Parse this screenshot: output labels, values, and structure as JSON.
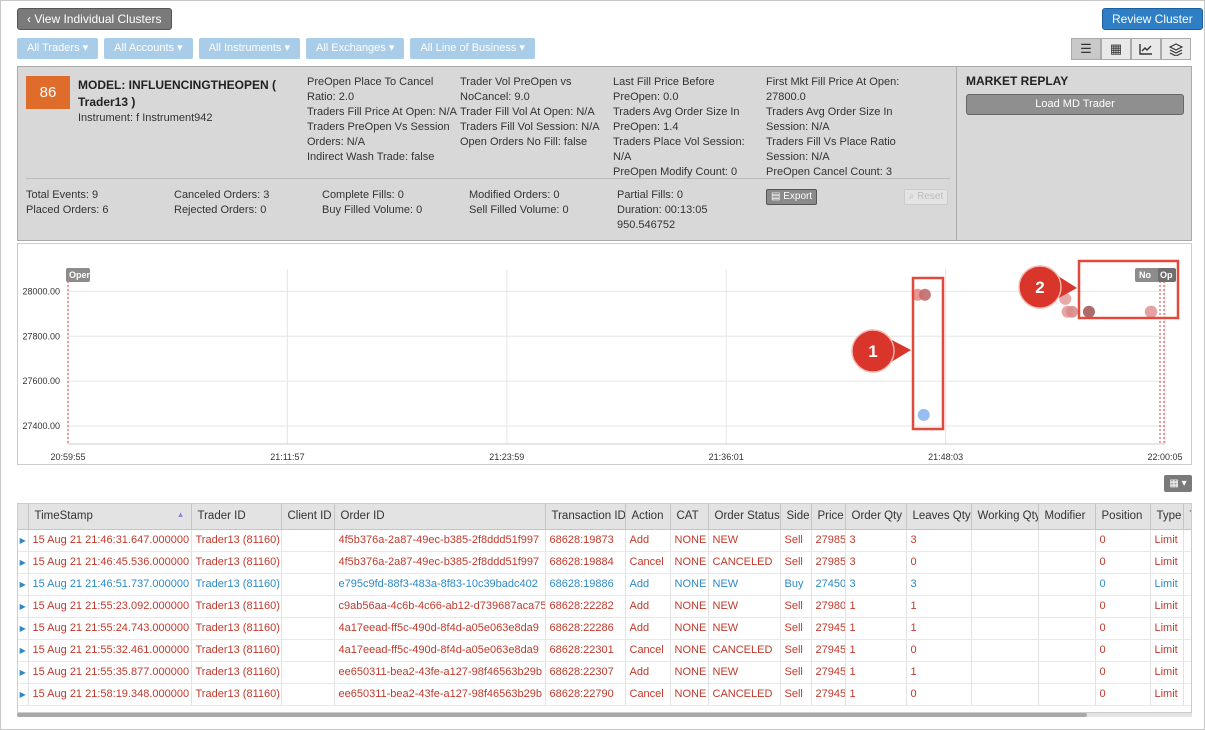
{
  "toolbar": {
    "back_label": "View Individual Clusters",
    "review_label": "Review Cluster",
    "filters": [
      "All Traders",
      "All Accounts",
      "All Instruments",
      "All Exchanges",
      "All Line of Business"
    ]
  },
  "cluster": {
    "score": "86",
    "model": "MODEL: INFLUENCINGTHEOPEN ( Trader13 )",
    "instrument": "Instrument: f Instrument942",
    "metrics_col1": [
      "PreOpen Place To Cancel Ratio: 2.0",
      "Traders Fill Price At Open: N/A",
      "Traders PreOpen Vs Session Orders: N/A",
      "Indirect Wash Trade: false"
    ],
    "metrics_col2": [
      "Trader Vol PreOpen vs NoCancel: 9.0",
      "Trader Fill Vol At Open: N/A",
      "Traders Fill Vol Session: N/A",
      "Open Orders No Fill: false"
    ],
    "metrics_col3": [
      "Last Fill Price Before PreOpen: 0.0",
      "Traders Avg Order Size In PreOpen: 1.4",
      "Traders Place Vol Session: N/A",
      "PreOpen Modify Count: 0"
    ],
    "metrics_col4": [
      "First Mkt Fill Price At Open: 27800.0",
      "Traders Avg Order Size In Session: N/A",
      "Traders Fill Vs Place Ratio Session: N/A",
      "PreOpen Cancel Count: 3"
    ],
    "stats": {
      "total_events": "Total Events: 9",
      "placed_orders": "Placed Orders: 6",
      "canceled_orders": "Canceled Orders: 3",
      "rejected_orders": "Rejected Orders: 0",
      "complete_fills": "Complete Fills: 0",
      "buy_filled": "Buy Filled Volume: 0",
      "modified_orders": "Modified Orders: 0",
      "sell_filled": "Sell Filled Volume: 0",
      "partial_fills": "Partial Fills: 0",
      "duration": "Duration: 00:13:05",
      "duration_ms": "950.546752"
    },
    "export_label": "Export",
    "reset_label": "Reset"
  },
  "market_replay": {
    "title": "MARKET REPLAY",
    "load_label": "Load MD Trader"
  },
  "chart_data": {
    "type": "scatter",
    "y_ticks": [
      "28000.00",
      "27800.00",
      "27600.00",
      "27400.00"
    ],
    "x_ticks": [
      "20:59:55",
      "21:11:57",
      "21:23:59",
      "21:36:01",
      "21:48:03",
      "22:00:05"
    ],
    "ylim": [
      27320,
      28100
    ],
    "grid": true,
    "labels": {
      "open_left": "Open",
      "no_left": "No",
      "open_right": "Op"
    },
    "callouts": [
      "1",
      "2"
    ],
    "series": [
      {
        "values": [
          {
            "x": "21:46:31",
            "y": 27985,
            "color": "#e98a8a"
          },
          {
            "x": "21:46:45",
            "y": 27985,
            "color": "#c26b6b"
          },
          {
            "x": "21:46:51",
            "y": 27450,
            "color": "#8cb6f0"
          },
          {
            "x": "21:55:23",
            "y": 27980,
            "color": "#e6a0a0"
          },
          {
            "x": "21:55:24",
            "y": 27945,
            "color": "#e69a9a"
          },
          {
            "x": "21:55:32",
            "y": 27945,
            "color": "#d88d8d"
          },
          {
            "x": "21:55:35",
            "y": 27945,
            "color": "#a45a5a"
          },
          {
            "x": "21:58:19",
            "y": 27945,
            "color": "#d98f8f"
          },
          {
            "x": "21:59:20",
            "y": 27945,
            "color": "#e4a3a3"
          }
        ]
      }
    ]
  },
  "table": {
    "columns": [
      "TimeStamp",
      "Trader ID",
      "Client ID",
      "Order ID",
      "Transaction ID",
      "Action",
      "CAT",
      "Order Status",
      "Side",
      "Price",
      "Order Qty",
      "Leaves Qty",
      "Working Qty",
      "Modifier",
      "Position",
      "Type",
      "T"
    ],
    "rows": [
      {
        "side": "sell",
        "cells": [
          "15 Aug 21 21:46:31.647.000000",
          "Trader13 (81160)",
          "",
          "4f5b376a-2a87-49ec-b385-2f8ddd51f997",
          "68628:19873",
          "Add",
          "NONE",
          "NEW",
          "Sell",
          "27985",
          "3",
          "3",
          "",
          "",
          "0",
          "Limit",
          ""
        ]
      },
      {
        "side": "sell",
        "cells": [
          "15 Aug 21 21:46:45.536.000000",
          "Trader13 (81160)",
          "",
          "4f5b376a-2a87-49ec-b385-2f8ddd51f997",
          "68628:19884",
          "Cancel",
          "NONE",
          "CANCELED",
          "Sell",
          "27985",
          "3",
          "0",
          "",
          "",
          "0",
          "Limit",
          ""
        ]
      },
      {
        "side": "buy",
        "cells": [
          "15 Aug 21 21:46:51.737.000000",
          "Trader13 (81160)",
          "",
          "e795c9fd-88f3-483a-8f83-10c39badc402",
          "68628:19886",
          "Add",
          "NONE",
          "NEW",
          "Buy",
          "27450",
          "3",
          "3",
          "",
          "",
          "0",
          "Limit",
          ""
        ]
      },
      {
        "side": "sell",
        "cells": [
          "15 Aug 21 21:55:23.092.000000",
          "Trader13 (81160)",
          "",
          "c9ab56aa-4c6b-4c66-ab12-d739687aca75",
          "68628:22282",
          "Add",
          "NONE",
          "NEW",
          "Sell",
          "27980",
          "1",
          "1",
          "",
          "",
          "0",
          "Limit",
          ""
        ]
      },
      {
        "side": "sell",
        "cells": [
          "15 Aug 21 21:55:24.743.000000",
          "Trader13 (81160)",
          "",
          "4a17eead-ff5c-490d-8f4d-a05e063e8da9",
          "68628:22286",
          "Add",
          "NONE",
          "NEW",
          "Sell",
          "27945",
          "1",
          "1",
          "",
          "",
          "0",
          "Limit",
          ""
        ]
      },
      {
        "side": "sell",
        "cells": [
          "15 Aug 21 21:55:32.461.000000",
          "Trader13 (81160)",
          "",
          "4a17eead-ff5c-490d-8f4d-a05e063e8da9",
          "68628:22301",
          "Cancel",
          "NONE",
          "CANCELED",
          "Sell",
          "27945",
          "1",
          "0",
          "",
          "",
          "0",
          "Limit",
          ""
        ]
      },
      {
        "side": "sell",
        "cells": [
          "15 Aug 21 21:55:35.877.000000",
          "Trader13 (81160)",
          "",
          "ee650311-bea2-43fe-a127-98f46563b29b",
          "68628:22307",
          "Add",
          "NONE",
          "NEW",
          "Sell",
          "27945",
          "1",
          "1",
          "",
          "",
          "0",
          "Limit",
          ""
        ]
      },
      {
        "side": "sell",
        "cells": [
          "15 Aug 21 21:58:19.348.000000",
          "Trader13 (81160)",
          "",
          "ee650311-bea2-43fe-a127-98f46563b29b",
          "68628:22790",
          "Cancel",
          "NONE",
          "CANCELED",
          "Sell",
          "27945",
          "1",
          "0",
          "",
          "",
          "0",
          "Limit",
          ""
        ]
      }
    ]
  }
}
